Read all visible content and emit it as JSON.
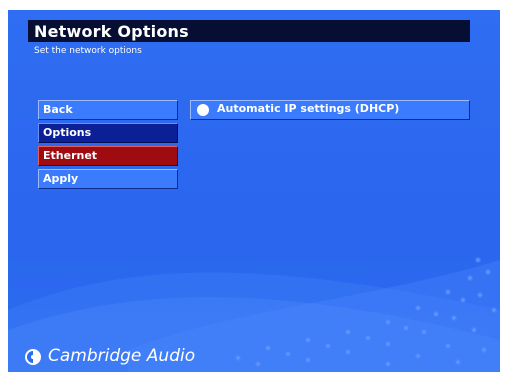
{
  "header": {
    "title": "Network Options",
    "subtitle": "Set the network options"
  },
  "menu": {
    "items": [
      {
        "label": "Back",
        "state": "normal"
      },
      {
        "label": "Options",
        "state": "selected"
      },
      {
        "label": "Ethernet",
        "state": "active"
      },
      {
        "label": "Apply",
        "state": "normal"
      }
    ]
  },
  "options": [
    {
      "label": "Automatic IP settings (DHCP)",
      "icon": "radio-icon"
    }
  ],
  "brand": {
    "name": "Cambridge Audio",
    "icon": "cambridge-audio-logo-icon"
  },
  "colors": {
    "background": "#2f6df2",
    "title_bar": "#060e33",
    "item_normal": "#3b7cff",
    "item_selected": "#0b1f96",
    "item_active": "#9e0b10"
  }
}
